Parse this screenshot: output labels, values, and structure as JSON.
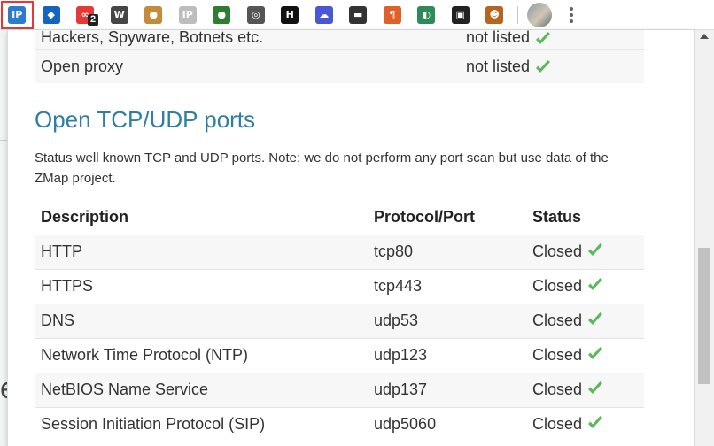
{
  "toolbar": {
    "extensions": [
      {
        "name": "ip-info-extension",
        "label": "IP",
        "color": "#2b7bd0",
        "active": true
      },
      {
        "name": "blue-red-diamond-extension",
        "label": "◆",
        "color": "#1565c0"
      },
      {
        "name": "link-extension",
        "label": "∞",
        "color": "#e53935",
        "badge": "2"
      },
      {
        "name": "wordpress-extension",
        "label": "W",
        "color": "#464646"
      },
      {
        "name": "cookie-extension",
        "label": "●",
        "color": "#c58b3a"
      },
      {
        "name": "ip-grey-extension",
        "label": "IP",
        "color": "#bdbdbd"
      },
      {
        "name": "green-ball-extension",
        "label": "●",
        "color": "#2e7d32"
      },
      {
        "name": "eye-extension",
        "label": "◎",
        "color": "#555555"
      },
      {
        "name": "h-extension",
        "label": "H",
        "color": "#111111"
      },
      {
        "name": "cloud-extension",
        "label": "☁",
        "color": "#4a56d4"
      },
      {
        "name": "mask-extension",
        "label": "▬",
        "color": "#333333"
      },
      {
        "name": "paragraph-extension",
        "label": "¶",
        "color": "#e0602a"
      },
      {
        "name": "globe-extension",
        "label": "◐",
        "color": "#2e8b57"
      },
      {
        "name": "tab-extension",
        "label": "▣",
        "color": "#222222"
      },
      {
        "name": "monkey-extension",
        "label": "☻",
        "color": "#b5651d"
      }
    ]
  },
  "blacklist": {
    "rows": [
      {
        "description": "Hackers, Spyware, Botnets etc.",
        "status": "not listed"
      },
      {
        "description": "Open proxy",
        "status": "not listed"
      }
    ]
  },
  "ports_section": {
    "title": "Open TCP/UDP ports",
    "description": "Status well known TCP and UDP ports. Note: we do not perform any port scan but use data of the ZMap project.",
    "headers": {
      "description": "Description",
      "protocol": "Protocol/Port",
      "status": "Status"
    },
    "rows": [
      {
        "description": "HTTP",
        "protocol": "tcp80",
        "status": "Closed"
      },
      {
        "description": "HTTPS",
        "protocol": "tcp443",
        "status": "Closed"
      },
      {
        "description": "DNS",
        "protocol": "udp53",
        "status": "Closed"
      },
      {
        "description": "Network Time Protocol (NTP)",
        "protocol": "udp123",
        "status": "Closed"
      },
      {
        "description": "NetBIOS Name Service",
        "protocol": "udp137",
        "status": "Closed"
      },
      {
        "description": "Session Initiation Protocol (SIP)",
        "protocol": "udp5060",
        "status": "Closed"
      }
    ]
  },
  "colors": {
    "check": "#5cb85c",
    "heading": "#2f7ea6"
  }
}
